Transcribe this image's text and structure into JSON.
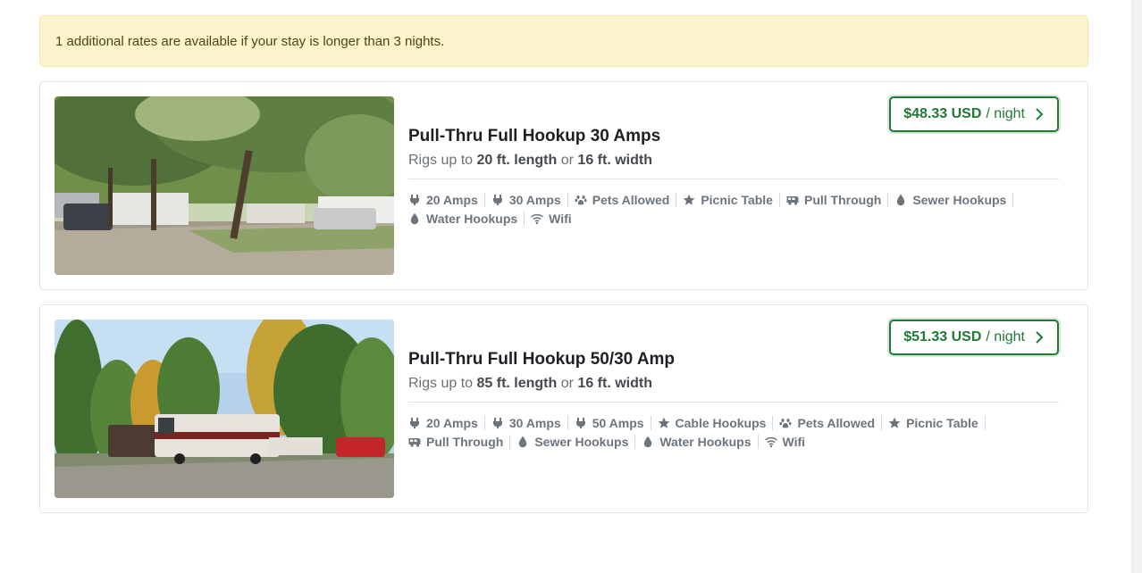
{
  "notice": {
    "text": "1 additional rates are available if your stay is longer than 3 nights."
  },
  "sites": [
    {
      "price_amount": "$48.33 USD",
      "price_unit": "/ night",
      "title": "Pull-Thru Full Hookup 30 Amps",
      "rig_prefix": "Rigs up to",
      "rig_length": "20 ft. length",
      "rig_or": "or",
      "rig_width": "16 ft. width",
      "amenities": [
        {
          "label": "20 Amps",
          "icon": "plug-icon"
        },
        {
          "label": "30 Amps",
          "icon": "plug-icon"
        },
        {
          "label": "Pets Allowed",
          "icon": "paw-icon"
        },
        {
          "label": "Picnic Table",
          "icon": "star-icon"
        },
        {
          "label": "Pull Through",
          "icon": "rv-icon"
        },
        {
          "label": "Sewer Hookups",
          "icon": "drop-icon"
        },
        {
          "label": "Water Hookups",
          "icon": "drop-icon"
        },
        {
          "label": "Wifi",
          "icon": "wifi-icon"
        }
      ]
    },
    {
      "price_amount": "$51.33 USD",
      "price_unit": "/ night",
      "title": "Pull-Thru Full Hookup 50/30 Amp",
      "rig_prefix": "Rigs up to",
      "rig_length": "85 ft. length",
      "rig_or": "or",
      "rig_width": "16 ft. width",
      "amenities": [
        {
          "label": "20 Amps",
          "icon": "plug-icon"
        },
        {
          "label": "30 Amps",
          "icon": "plug-icon"
        },
        {
          "label": "50 Amps",
          "icon": "plug-icon"
        },
        {
          "label": "Cable Hookups",
          "icon": "star-icon"
        },
        {
          "label": "Pets Allowed",
          "icon": "paw-icon"
        },
        {
          "label": "Picnic Table",
          "icon": "star-icon"
        },
        {
          "label": "Pull Through",
          "icon": "rv-icon"
        },
        {
          "label": "Sewer Hookups",
          "icon": "drop-icon"
        },
        {
          "label": "Water Hookups",
          "icon": "drop-icon"
        },
        {
          "label": "Wifi",
          "icon": "wifi-icon"
        }
      ]
    }
  ],
  "colors": {
    "accent": "#1f7a33",
    "notice_bg": "#fdf3cd",
    "muted": "#6c757d"
  }
}
